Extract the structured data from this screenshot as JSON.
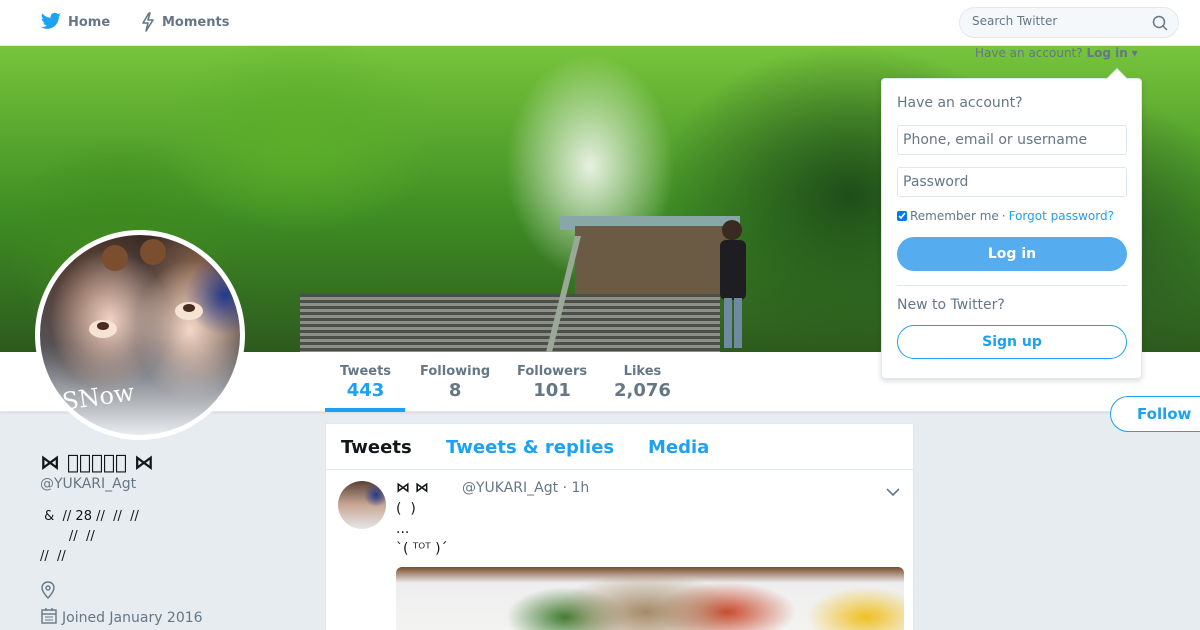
{
  "nav": {
    "home_label": "Home",
    "moments_label": "Moments",
    "search_placeholder": "Search Twitter"
  },
  "banner": {
    "hint_text": "Have an account?",
    "hint_link": "Log in"
  },
  "stats": [
    {
      "label": "Tweets",
      "value": "443"
    },
    {
      "label": "Following",
      "value": "8"
    },
    {
      "label": "Followers",
      "value": "101"
    },
    {
      "label": "Likes",
      "value": "2,076"
    }
  ],
  "follow_label": "Follow",
  "avatar": {
    "overlay_text": "SNow"
  },
  "profile": {
    "name": "⋈ ﾟﾟﾟﾟﾟ ⋈",
    "handle": "@YUKARI_Agt",
    "bio": " &  // 28 //  //  //\n       //  //\n//  //",
    "joined": "Joined January 2016"
  },
  "timeline": {
    "tabs": [
      "Tweets",
      "Tweets & replies",
      "Media"
    ],
    "tweet": {
      "name": "⋈  ⋈",
      "meta": "@YUKARI_Agt · 1h",
      "text": "(  )\n...\n`( ᵀᴼᵀ )´"
    }
  },
  "login": {
    "heading": "Have an account?",
    "username_placeholder": "Phone, email or username",
    "password_placeholder": "Password",
    "remember_label": "Remember me",
    "separator": "·",
    "forgot_label": "Forgot password?",
    "login_label": "Log in",
    "new_label": "New to Twitter?",
    "signup_label": "Sign up"
  },
  "colors": {
    "accent": "#1da1f2",
    "login_button": "#55acee",
    "muted": "#657786",
    "page_bg": "#e6ecf0"
  },
  "icons": [
    "twitter-bird-icon",
    "lightning-icon",
    "search-icon",
    "location-pin-icon",
    "calendar-icon",
    "chevron-down-icon"
  ]
}
